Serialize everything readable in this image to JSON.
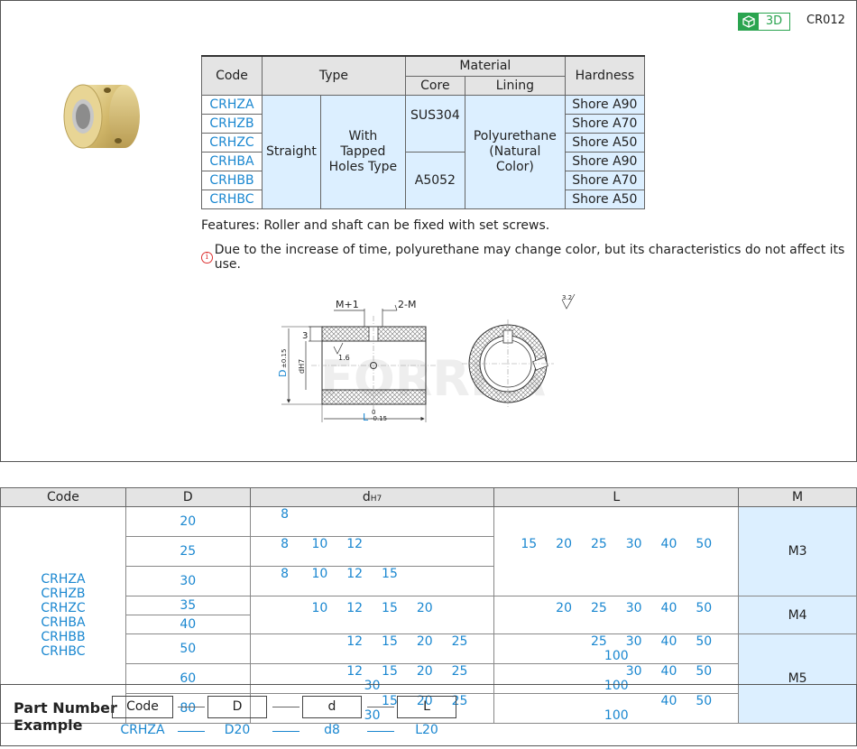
{
  "header": {
    "badge_3d": "3D",
    "code": "CR012"
  },
  "spec_table": {
    "headers": {
      "code": "Code",
      "type": "Type",
      "material": "Material",
      "core": "Core",
      "lining": "Lining",
      "hardness": "Hardness"
    },
    "type_1": "Straight",
    "type_2": "With Tapped Holes Type",
    "cores": [
      "SUS304",
      "A5052"
    ],
    "lining": "Polyurethane (Natural Color)",
    "rows": [
      {
        "code": "CRHZA",
        "hardness": "Shore A90"
      },
      {
        "code": "CRHZB",
        "hardness": "Shore A70"
      },
      {
        "code": "CRHZC",
        "hardness": "Shore A50"
      },
      {
        "code": "CRHBA",
        "hardness": "Shore A90"
      },
      {
        "code": "CRHBB",
        "hardness": "Shore A70"
      },
      {
        "code": "CRHBC",
        "hardness": "Shore A50"
      }
    ]
  },
  "features": "Features: Roller and shaft can be fixed with set screws.",
  "notice": "Due to the increase of time, polyurethane may change color, but its characteristics do not affect its use.",
  "drawing": {
    "m_plus_1": "M+1",
    "two_m": "2-M",
    "three": "3",
    "rough_16": "1.6",
    "rough_32": "3.2",
    "d_label": "D",
    "d_tol": "±0.15",
    "dh7": "dH7",
    "l_label": "L",
    "l_tol_top": "0",
    "l_tol_bot": "-0.15",
    "watermark": "FORRRA"
  },
  "dims_table": {
    "headers": {
      "code": "Code",
      "d": "D",
      "dh7": "dH7",
      "l": "L",
      "m": "M"
    },
    "codes": [
      "CRHZA",
      "CRHZB",
      "CRHZC",
      "CRHBA",
      "CRHBB",
      "CRHBC"
    ],
    "rows": [
      {
        "D": "20",
        "d": [
          "8",
          "",
          "",
          "",
          "",
          "",
          ""
        ]
      },
      {
        "D": "25",
        "d": [
          "8",
          "10",
          "12",
          "",
          "",
          "",
          ""
        ]
      },
      {
        "D": "30",
        "d": [
          "8",
          "10",
          "12",
          "15",
          "",
          "",
          ""
        ]
      },
      {
        "D": "35",
        "d": [
          "",
          "10",
          "12",
          "15",
          "20",
          "",
          ""
        ]
      },
      {
        "D": "40",
        "d": [
          "",
          "",
          "",
          "",
          "",
          "",
          ""
        ]
      },
      {
        "D": "50",
        "d": [
          "",
          "",
          "12",
          "15",
          "20",
          "25",
          ""
        ]
      },
      {
        "D": "60",
        "d": [
          "",
          "",
          "12",
          "15",
          "20",
          "25",
          "30"
        ]
      },
      {
        "D": "80",
        "d": [
          "",
          "",
          "",
          "15",
          "20",
          "25",
          "30"
        ]
      }
    ],
    "L_groups": [
      [
        "15",
        "20",
        "25",
        "30",
        "40",
        "50",
        ""
      ],
      [
        "",
        "20",
        "25",
        "30",
        "40",
        "50",
        ""
      ],
      [
        "",
        "",
        "25",
        "30",
        "40",
        "50",
        "100"
      ],
      [
        "",
        "",
        "",
        "30",
        "40",
        "50",
        "100"
      ],
      [
        "",
        "",
        "",
        "",
        "40",
        "50",
        "100"
      ]
    ],
    "M_values": [
      "M3",
      "M4",
      "M5"
    ]
  },
  "part_number": {
    "title_1": "Part Number",
    "title_2": "Example",
    "fields": [
      "Code",
      "D",
      "d",
      "L"
    ],
    "example": [
      "CRHZA",
      "D20",
      "d8",
      "L20"
    ]
  },
  "colors": {
    "accent": "#1a87d0",
    "highlight": "#dcefff",
    "green": "#2aa44f"
  }
}
